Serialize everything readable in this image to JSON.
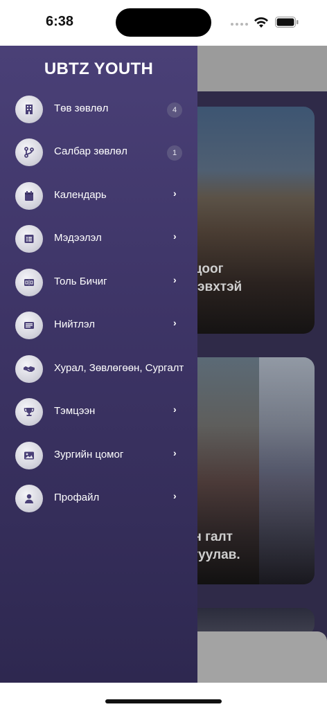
{
  "status_bar": {
    "time": "6:38"
  },
  "drawer": {
    "title": "UBTZ YOUTH",
    "items": [
      {
        "label": "Төв зөвлөл",
        "icon": "building-icon",
        "badge": "4"
      },
      {
        "label": "Салбар зөвлөл",
        "icon": "branch-icon",
        "badge": "1"
      },
      {
        "label": "Календарь",
        "icon": "calendar-icon",
        "chevron": "›"
      },
      {
        "label": "Мэдээлэл",
        "icon": "list-icon",
        "chevron": "›"
      },
      {
        "label": "Толь Бичиг",
        "icon": "dictionary-icon",
        "chevron": "›"
      },
      {
        "label": "Нийтлэл",
        "icon": "article-icon",
        "chevron": "›"
      },
      {
        "label": "Хурал, Зөвлөгөөн, Сургалт",
        "icon": "handshake-icon"
      },
      {
        "label": "Тэмцээн",
        "icon": "trophy-icon",
        "chevron": "›"
      },
      {
        "label": "Зургийн цомог",
        "icon": "image-icon",
        "chevron": "›"
      },
      {
        "label": "Профайл",
        "icon": "user-icon",
        "chevron": "›"
      }
    ]
  },
  "background": {
    "card1_caption": "илцоог\n идэвхтэй",
    "card2_caption": "ийн галт\nайгуулав."
  },
  "colors": {
    "drawer_top": "#4a4077",
    "drawer_bottom": "#2e2850",
    "badge": "#5c5680"
  }
}
